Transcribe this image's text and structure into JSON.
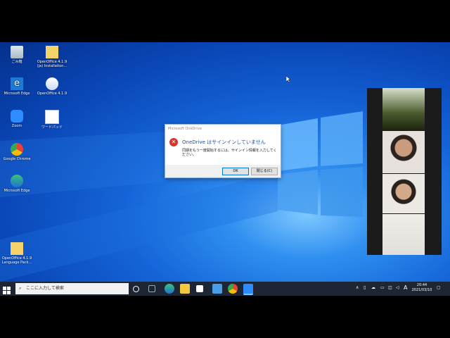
{
  "desktop_icons": [
    {
      "label": "ごみ箱",
      "icon": "recycle-bin-icon"
    },
    {
      "label": "OpenOffice 4.1.9 (ja) Installation...",
      "icon": "folder-icon"
    },
    {
      "label": "Microsoft Edge",
      "icon": "edge-icon"
    },
    {
      "label": "OpenOffice 4.1.9",
      "icon": "openoffice-icon"
    },
    {
      "label": "Zoom",
      "icon": "zoom-icon"
    },
    {
      "label": "ワードパッド",
      "icon": "wordpad-icon"
    },
    {
      "label": "Google Chrome",
      "icon": "chrome-icon"
    },
    {
      "label": "Microsoft Edge",
      "icon": "edge-icon"
    },
    {
      "label": "OpenOffice 4.1.9 Language Pack...",
      "icon": "folder-icon"
    }
  ],
  "dialog": {
    "title": "Microsoft OneDrive",
    "heading": "OneDrive はサインインしていません",
    "message": "同期をもう一度開始するには、サインイン情報を入力してください。",
    "ok_label": "OK",
    "close_label": "閉じる(C)"
  },
  "taskbar": {
    "search_placeholder": "ここに入力して検索",
    "tray_ime": "A",
    "time": "20:44",
    "date": "2021/03/10"
  },
  "colors": {
    "taskbar": "#1d2634",
    "accent": "#0078d7",
    "error": "#d9342b"
  }
}
